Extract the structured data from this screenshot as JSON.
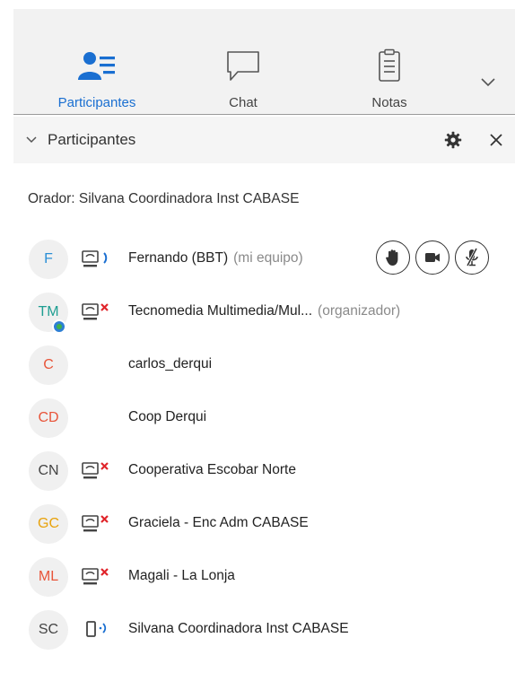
{
  "tabs": [
    {
      "label": "Participantes",
      "icon": "participants-icon",
      "active": true
    },
    {
      "label": "Chat",
      "icon": "chat-icon",
      "active": false
    },
    {
      "label": "Notas",
      "icon": "notes-icon",
      "active": false
    }
  ],
  "panel": {
    "title": "Participantes"
  },
  "speaker": {
    "text": "Orador: Silvana Coordinadora Inst CABASE"
  },
  "participants": [
    {
      "initials": "F",
      "color": "#2b8fd6",
      "name": "Fernando (BBT)",
      "tag": "(mi equipo)",
      "device": "computer-audio-icon"
    },
    {
      "initials": "TM",
      "color": "#1f9e92",
      "name": "Tecnomedia Multimedia/Mul...",
      "tag": "(organizador)",
      "device": "computer-muted-icon"
    },
    {
      "initials": "C",
      "color": "#e8553a",
      "name": "carlos_derqui",
      "tag": "",
      "device": ""
    },
    {
      "initials": "CD",
      "color": "#e8553a",
      "name": "Coop Derqui",
      "tag": "",
      "device": ""
    },
    {
      "initials": "CN",
      "color": "#444444",
      "name": "Cooperativa Escobar Norte",
      "tag": "",
      "device": "computer-muted-icon"
    },
    {
      "initials": "GC",
      "color": "#e8a20c",
      "name": "Graciela - Enc Adm CABASE",
      "tag": "",
      "device": "computer-muted-icon"
    },
    {
      "initials": "ML",
      "color": "#e8553a",
      "name": "Magali - La Lonja",
      "tag": "",
      "device": "computer-muted-icon"
    },
    {
      "initials": "SC",
      "color": "#444444",
      "name": "Silvana Coordinadora Inst CABASE",
      "tag": "",
      "device": "phone-audio-icon"
    }
  ],
  "colors": {
    "accent": "#1a6fd1",
    "muted_x": "#e0252b"
  }
}
